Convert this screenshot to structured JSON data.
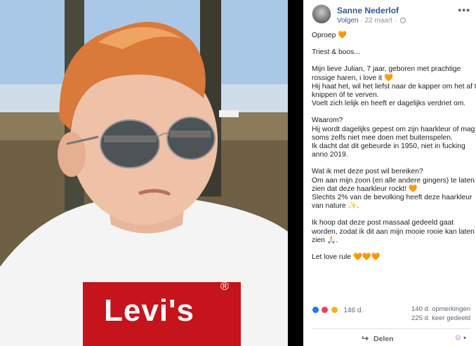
{
  "post": {
    "author": "Sanne Nederlof",
    "follow_label": "Volgen",
    "date": "22 maart",
    "more_icon": "•••",
    "paragraphs": [
      [
        "Oproep 🧡"
      ],
      [
        "Triest & boos..."
      ],
      [
        "Mijn lieve Julian, 7 jaar, geboren met prachtige",
        "rossige haren, i love it 🧡",
        "Hij haat het, wil het liefst naar de kapper om het af te",
        "knippen óf te verven.",
        "Voelt zich lelijk en heeft er dagelijks verdriet om."
      ],
      [
        "Waarom?",
        "Hij wordt dagelijks gepest om zijn haarkleur of mag",
        "soms zelfs niet mee doen met buitenspelen.",
        "Ik dacht dat dit gebeurde in 1950, niet in fucking",
        "anno 2019."
      ],
      [
        "Wat ik met deze post wil bereiken?",
        "Om aan mijn zoon (en alle andere gingers) te laten",
        "zien dat deze haarkleur rockt! 🧡",
        "Slechts 2% van de bevolking heeft deze haarkleur",
        "van nature ✨."
      ],
      [
        "Ik hoop dat deze post massaal gedeeld gaat",
        "worden, zodat ik dit aan mijn mooie rooie kan laten",
        "zien 🙏🏻."
      ],
      [
        "Let love rule 🧡🧡🧡"
      ]
    ]
  },
  "reactions": {
    "count": "146 d.",
    "comments": "140 d. opmerkingen",
    "shares": "225 d. keer gedeeld"
  },
  "actions": {
    "share_label": "Delen",
    "share_icon": "↪",
    "emoji_icon": "☺",
    "caret": "▾"
  },
  "photo": {
    "shirt_brand": "Levi's",
    "shirt_mark": "®"
  }
}
